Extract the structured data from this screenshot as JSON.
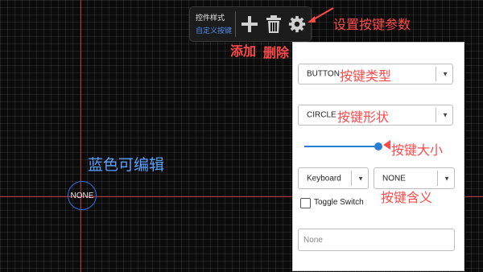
{
  "toolbar": {
    "title": "控件样式",
    "subtitle": "自定义按键",
    "icons": {
      "add": "plus-icon",
      "delete": "trash-icon",
      "settings": "gear-icon"
    }
  },
  "annotations": {
    "settings": "设置按键参数",
    "add": "添加",
    "delete": "删除",
    "blue_editable": "蓝色可编辑",
    "key_type": "按键类型",
    "key_shape": "按键形状",
    "key_size": "按键大小",
    "key_meaning": "按键含义"
  },
  "canvas": {
    "button_label": "NONE"
  },
  "panel": {
    "type_select": {
      "value": "BUTTON"
    },
    "shape_select": {
      "value": "CIRCLE"
    },
    "size_slider": {
      "value": 0.86
    },
    "input_kind_select": {
      "value": "Keyboard"
    },
    "key_select": {
      "value": "NONE"
    },
    "toggle_switch": {
      "label": "Toggle Switch",
      "checked": false
    },
    "text_field": {
      "placeholder": "None"
    }
  },
  "colors": {
    "accent_blue": "#2a7fd4",
    "annotation_red": "#ff4a4a",
    "editable_blue": "#5aa0ff",
    "axis_red": "#b8313a"
  }
}
